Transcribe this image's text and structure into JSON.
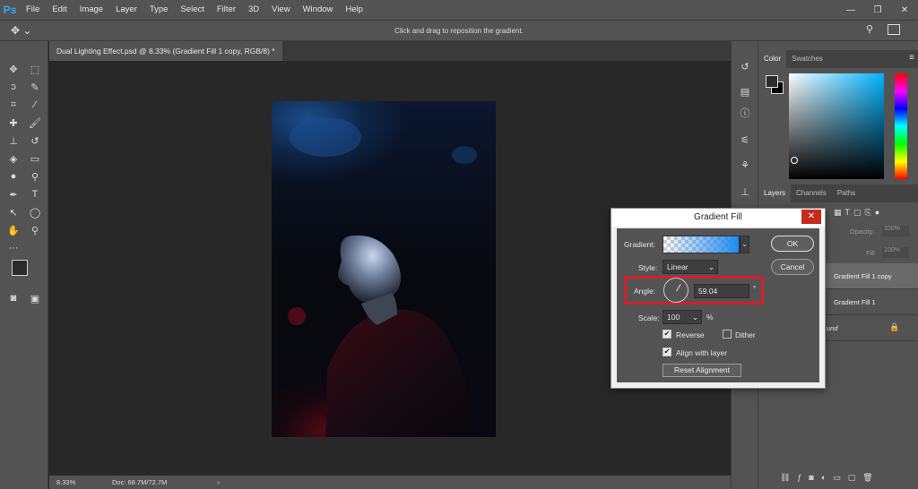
{
  "app": {
    "logo": "Ps"
  },
  "menu": [
    "File",
    "Edit",
    "Image",
    "Layer",
    "Type",
    "Select",
    "Filter",
    "3D",
    "View",
    "Window",
    "Help"
  ],
  "window_controls": {
    "minimize": "—",
    "restore": "❐",
    "close": "✕"
  },
  "options_bar": {
    "hint": "Click and drag to reposition the gradient."
  },
  "document": {
    "tab_title": "Dual Lighting Effect.psd @ 8.33% (Gradient Fill 1 copy, RGB/8) *"
  },
  "status": {
    "zoom": "8.33%",
    "doc_size": "Doc: 68.7M/72.7M"
  },
  "color_panel": {
    "tabs": [
      "Color",
      "Swatches"
    ]
  },
  "layers_panel": {
    "tabs": [
      "Layers",
      "Channels",
      "Paths"
    ],
    "opacity_label": "Opacity:",
    "opacity_value": "100%",
    "fill_label": "Fill:",
    "fill_value": "100%",
    "layers": [
      "Gradient Fill 1 copy",
      "Gradient Fill 1",
      "und"
    ]
  },
  "dialog": {
    "title": "Gradient Fill",
    "close": "✕",
    "gradient_label": "Gradient:",
    "style_label": "Style:",
    "style_value": "Linear",
    "angle_label": "Angle:",
    "angle_value": "59.04",
    "angle_unit": "°",
    "scale_label": "Scale:",
    "scale_value": "100",
    "scale_unit": "%",
    "reverse_label": "Reverse",
    "reverse_checked": true,
    "dither_label": "Dither",
    "dither_checked": false,
    "align_label": "Align with layer",
    "align_checked": true,
    "reset_label": "Reset Alignment",
    "ok_label": "OK",
    "cancel_label": "Cancel"
  },
  "colors": {
    "highlight": "#d0202e",
    "ps_blue": "#31a8ff"
  }
}
